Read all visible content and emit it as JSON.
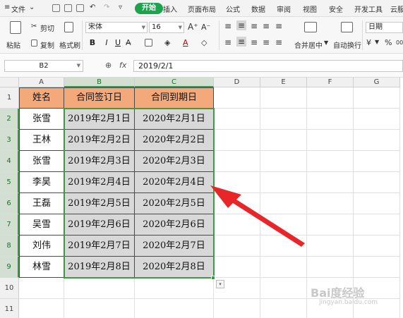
{
  "menu": {
    "file": "文件",
    "tabs": [
      "开始",
      "插入",
      "页面布局",
      "公式",
      "数据",
      "审阅",
      "视图",
      "安全",
      "开发工具",
      "云服"
    ]
  },
  "ribbon": {
    "paste": "粘贴",
    "cut": "剪切",
    "copy": "复制",
    "format_painter": "格式刷",
    "font_name": "宋体",
    "font_size": "16",
    "grow_font": "A⁺",
    "shrink_font": "A⁻",
    "bold": "B",
    "italic": "I",
    "underline": "U",
    "merge_center": "合并居中",
    "wrap_text": "自动换行",
    "number_format": "日期",
    "percent": "%",
    "thousands": "000"
  },
  "formula_bar": {
    "cell_ref": "B2",
    "zoom_glyph": "⊕",
    "fx": "fx",
    "value": "2019/2/1"
  },
  "sheet": {
    "columns": [
      "A",
      "B",
      "C",
      "D",
      "E",
      "F",
      "G"
    ],
    "rows": [
      "1",
      "2",
      "3",
      "4",
      "5",
      "6",
      "7",
      "8",
      "9",
      "10",
      "11"
    ],
    "headers": [
      "姓名",
      "合同签订日",
      "合同到期日"
    ],
    "data": [
      [
        "张雪",
        "2019年2月1日",
        "2020年2月1日"
      ],
      [
        "王林",
        "2019年2月2日",
        "2020年2月2日"
      ],
      [
        "张雪",
        "2019年2月3日",
        "2020年2月3日"
      ],
      [
        "李昊",
        "2019年2月4日",
        "2020年2月4日"
      ],
      [
        "王磊",
        "2019年2月5日",
        "2020年2月5日"
      ],
      [
        "吴雪",
        "2019年2月6日",
        "2020年2月6日"
      ],
      [
        "刘伟",
        "2019年2月7日",
        "2020年2月7日"
      ],
      [
        "林雪",
        "2019年2月8日",
        "2020年2月8日"
      ]
    ]
  },
  "watermark": {
    "brand": "Bai度经验",
    "url": "jingyan.baidu.com"
  },
  "colors": {
    "header_fill": "#f3a97a",
    "selection_fill": "#d8d8d8",
    "selection_border": "#3a9a48",
    "active_tab": "#1ba34d",
    "arrow": "#e8262a"
  }
}
